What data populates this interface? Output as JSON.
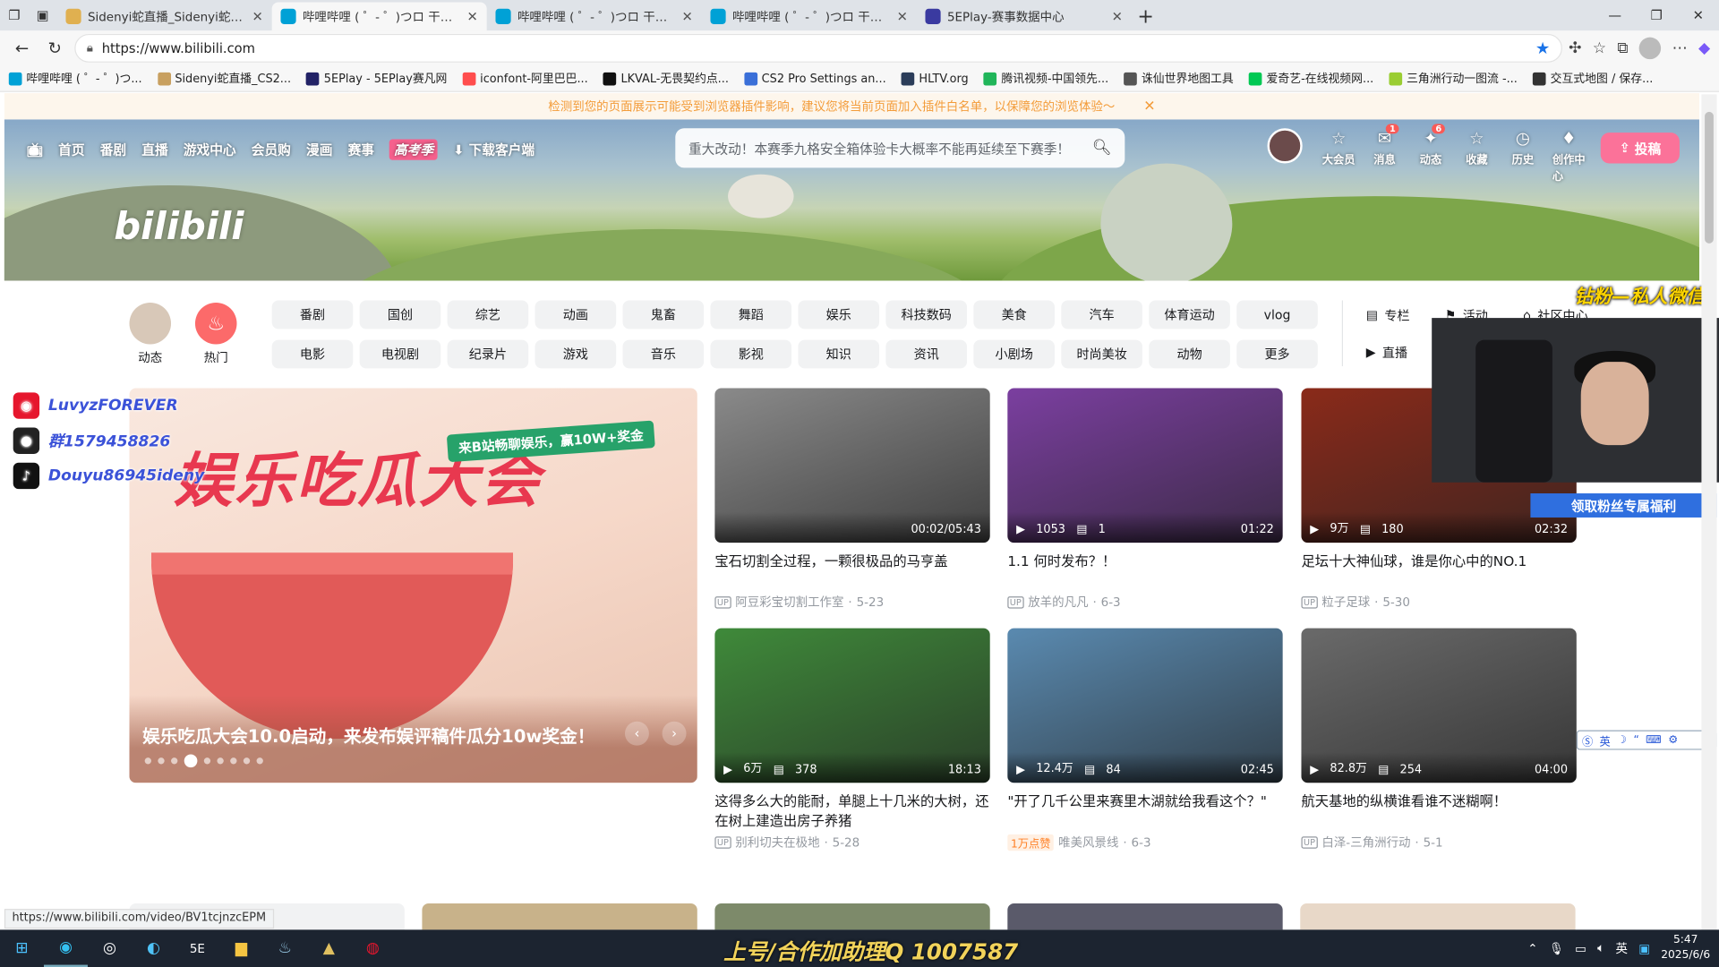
{
  "browser": {
    "tabs": [
      {
        "title": "Sidenyi蛇直播_Sidenyi蛇直播_Side",
        "active": false,
        "color": "#e0b050"
      },
      {
        "title": "哔哩哔哩 ( ゜- ゜)つロ 干杯~-bilib",
        "active": true,
        "color": "#00a1d6"
      },
      {
        "title": "哔哩哔哩 ( ゜- ゜)つロ 干杯~-bilib",
        "active": false,
        "color": "#00a1d6"
      },
      {
        "title": "哔哩哔哩 ( ゜- ゜)つロ 干杯~-bilib",
        "active": false,
        "color": "#00a1d6"
      },
      {
        "title": "5EPlay-赛事数据中心",
        "active": false,
        "color": "#3a3aa0"
      }
    ],
    "url": "https://www.bilibili.com",
    "bookmarks": [
      {
        "label": "哔哩哔哩 ( ゜- ゜)つ...",
        "color": "#00a1d6"
      },
      {
        "label": "Sidenyi蛇直播_CS2...",
        "color": "#c8a060"
      },
      {
        "label": "5EPlay - 5EPlay赛凡网",
        "color": "#222266"
      },
      {
        "label": "iconfont-阿里巴巴...",
        "color": "#ff4d4d"
      },
      {
        "label": "LKVAL-无畏契约点...",
        "color": "#111111"
      },
      {
        "label": "CS2 Pro Settings an...",
        "color": "#3a6fd8"
      },
      {
        "label": "HLTV.org",
        "color": "#2b3d5a"
      },
      {
        "label": "腾讯视频-中国领先...",
        "color": "#20b55a"
      },
      {
        "label": "诛仙世界地图工具",
        "color": "#555555"
      },
      {
        "label": "爱奇艺-在线视频网...",
        "color": "#00c853"
      },
      {
        "label": "三角洲行动一图流 -...",
        "color": "#9acd32"
      },
      {
        "label": "交互式地图 / 保存...",
        "color": "#333333"
      }
    ],
    "status_url": "https://www.bilibili.com/video/BV1tcjnzcEPM"
  },
  "notice": "检测到您的页面展示可能受到浏览器插件影响，建议您将当前页面加入插件白名单，以保障您的浏览体验～",
  "header": {
    "nav": [
      "首页",
      "番剧",
      "直播",
      "游戏中心",
      "会员购",
      "漫画",
      "赛事"
    ],
    "highlight": "高考季",
    "download": "下载客户端",
    "search_placeholder": "重大改动！本赛季九格安全箱体验卡大概率不能再延续至下赛季！",
    "logo": "bilibili",
    "right": [
      {
        "label": "大会员",
        "glyph": "☆",
        "badge": ""
      },
      {
        "label": "消息",
        "glyph": "✉",
        "badge": "1"
      },
      {
        "label": "动态",
        "glyph": "✦",
        "badge": "6"
      },
      {
        "label": "收藏",
        "glyph": "☆",
        "badge": ""
      },
      {
        "label": "历史",
        "glyph": "◷",
        "badge": ""
      },
      {
        "label": "创作中心",
        "glyph": "♦",
        "badge": ""
      }
    ],
    "upload": "投稿"
  },
  "channels": {
    "left": [
      {
        "label": "动态",
        "color": "#d8c8b8"
      },
      {
        "label": "热门",
        "color": "#fc6a6a"
      }
    ],
    "row1": [
      "番剧",
      "国创",
      "综艺",
      "动画",
      "鬼畜",
      "舞蹈",
      "娱乐",
      "科技数码",
      "美食",
      "汽车",
      "体育运动",
      "vlog"
    ],
    "row2": [
      "电影",
      "电视剧",
      "纪录片",
      "游戏",
      "音乐",
      "影视",
      "知识",
      "资讯",
      "小剧场",
      "时尚美妆",
      "动物",
      "更多"
    ],
    "right": [
      "专栏",
      "活动",
      "社区中心",
      "直播"
    ]
  },
  "carousel": {
    "headline": "娱乐吃瓜大会",
    "tag": "来B站畅聊娱乐，赢10W+奖金",
    "caption": "娱乐吃瓜大会10.0启动，来发布娱评稿件瓜分10w奖金！",
    "active_index": 3,
    "count": 9
  },
  "videos": [
    {
      "title": "宝石切割全过程，一颗很极品的马亨盖",
      "up": "阿豆彩宝切割工作室",
      "date": "5-23",
      "views": "",
      "danmaku": "",
      "duration": "00:02/05:43",
      "hot": "",
      "thumb": "#8a8a8a"
    },
    {
      "title": "1.1 何时发布？！",
      "up": "放羊的凡凡",
      "date": "6-3",
      "views": "1053",
      "danmaku": "1",
      "duration": "01:22",
      "hot": "",
      "thumb": "#7b3fa0"
    },
    {
      "title": "足坛十大神仙球，谁是你心中的NO.1",
      "up": "粒子足球",
      "date": "5-30",
      "views": "9万",
      "danmaku": "180",
      "duration": "02:32",
      "hot": "",
      "thumb": "#8a2a1a"
    },
    {
      "title": "这得多么大的能耐，单腿上十几米的大树，还在树上建造出房子养猪",
      "up": "别利切夫在极地",
      "date": "5-28",
      "views": "6万",
      "danmaku": "378",
      "duration": "18:13",
      "hot": "",
      "thumb": "#3f8a3a"
    },
    {
      "title": "\"开了几千公里来赛里木湖就给我看这个？\"",
      "up": "唯美风景线",
      "date": "6-3",
      "views": "12.4万",
      "danmaku": "84",
      "duration": "02:45",
      "hot": "1万点赞",
      "thumb": "#5a8ab0"
    },
    {
      "title": "航天基地的纵横谁看谁不迷糊啊！",
      "up": "白泽-三角洲行动",
      "date": "5-1",
      "views": "82.8万",
      "danmaku": "254",
      "duration": "04:00",
      "hot": "",
      "thumb": "#6a6a6a"
    }
  ],
  "overlays": {
    "social": [
      {
        "text": "LuvyzFOREVER",
        "icon": "weibo-icon",
        "color": "#e6162d"
      },
      {
        "text": "群1579458826",
        "icon": "qq-icon",
        "color": "#222222"
      },
      {
        "text": "Douyu86945ideny",
        "icon": "douyin-icon",
        "color": "#111111"
      }
    ],
    "fans_label": "钻粉—私人微信",
    "fans_button": "领取粉丝专属福利",
    "taskbar_text": "上号/合作加助理Q 1007587",
    "ime": "英"
  },
  "taskbar": {
    "time": "5:47",
    "date": "2025/6/6",
    "lang": "英"
  }
}
